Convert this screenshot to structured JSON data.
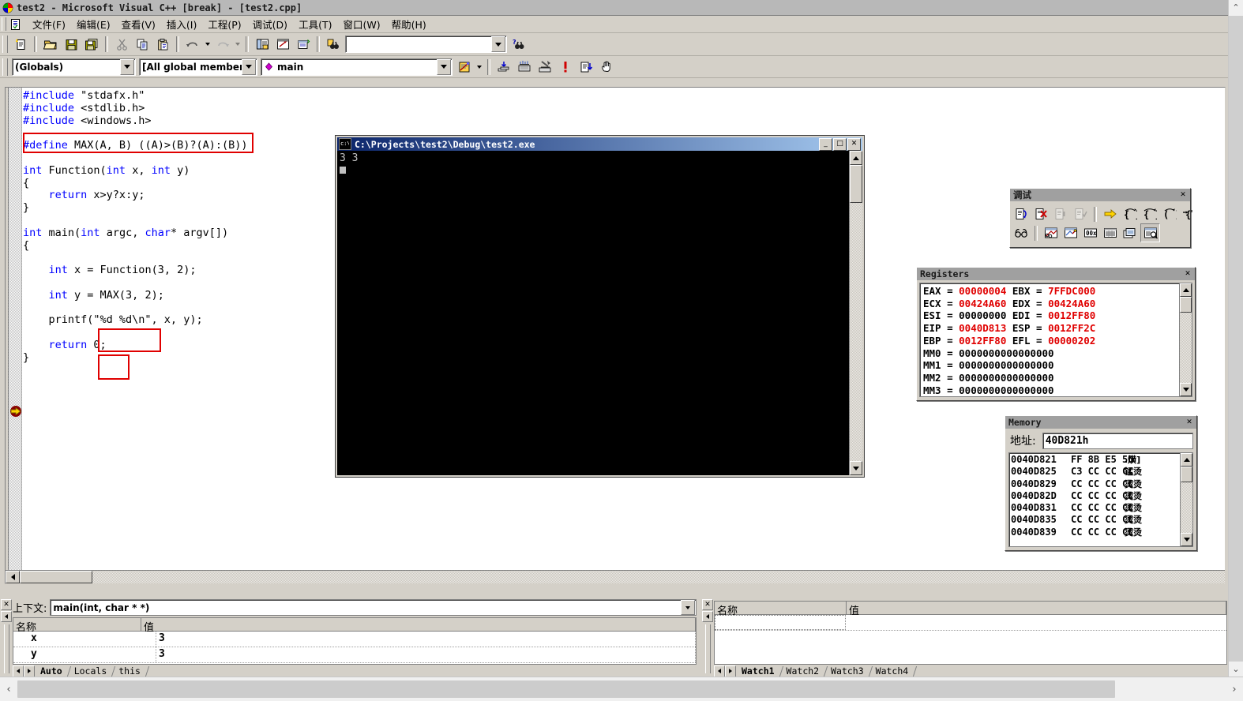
{
  "window": {
    "title": "test2 - Microsoft Visual C++ [break] - [test2.cpp]",
    "app_icon": "vc6-logo-icon"
  },
  "menubar": {
    "doc_icon": "document-icon",
    "items": [
      {
        "label": "文件(F)"
      },
      {
        "label": "编辑(E)"
      },
      {
        "label": "查看(V)"
      },
      {
        "label": "插入(I)"
      },
      {
        "label": "工程(P)"
      },
      {
        "label": "调试(D)"
      },
      {
        "label": "工具(T)"
      },
      {
        "label": "窗口(W)"
      },
      {
        "label": "帮助(H)"
      }
    ]
  },
  "standard_toolbar": {
    "buttons": [
      {
        "name": "new-text-file-button",
        "icon": "new-document-icon"
      },
      {
        "name": "open-button",
        "icon": "open-folder-icon"
      },
      {
        "name": "save-button",
        "icon": "floppy-save-icon"
      },
      {
        "name": "save-all-button",
        "icon": "floppy-save-all-icon"
      },
      {
        "name": "cut-button",
        "icon": "scissors-icon"
      },
      {
        "name": "copy-button",
        "icon": "copy-icon"
      },
      {
        "name": "paste-button",
        "icon": "clipboard-paste-icon"
      },
      {
        "name": "undo-button",
        "icon": "undo-arrow-icon"
      },
      {
        "name": "redo-button",
        "icon": "redo-arrow-icon"
      },
      {
        "name": "workspace-button",
        "icon": "workspace-window-icon"
      },
      {
        "name": "output-button",
        "icon": "output-window-icon"
      },
      {
        "name": "window-list-button",
        "icon": "window-list-icon"
      },
      {
        "name": "find-in-files-button",
        "icon": "binoculars-files-icon"
      }
    ],
    "find_box": {
      "value": "",
      "placeholder": ""
    },
    "help_button": {
      "name": "find-help-button",
      "icon": "question-binoculars-icon"
    }
  },
  "wizardbar": {
    "scope_combo": {
      "value": "(Globals)"
    },
    "members_combo": {
      "value": "[All global members]"
    },
    "function_combo": {
      "value": "main",
      "icon": "member-diamond-icon"
    },
    "action_button": {
      "name": "wizardbar-action-button",
      "icon": "wizard-action-icon"
    },
    "build_buttons": [
      {
        "name": "compile-button",
        "icon": "compile-icon"
      },
      {
        "name": "build-button",
        "icon": "build-icon"
      },
      {
        "name": "stop-build-button",
        "icon": "stop-build-icon"
      },
      {
        "name": "execute-program-button",
        "icon": "exclamation-run-icon"
      },
      {
        "name": "go-button",
        "icon": "go-debug-icon"
      },
      {
        "name": "insert-breakpoint-button",
        "icon": "hand-breakpoint-icon"
      }
    ]
  },
  "editor": {
    "filename": "test2.cpp",
    "lines": [
      {
        "tokens": [
          {
            "t": "#include",
            "c": "pp"
          },
          {
            "t": " \"stdafx.h\"",
            "c": ""
          }
        ]
      },
      {
        "tokens": [
          {
            "t": "#include",
            "c": "pp"
          },
          {
            "t": " <stdlib.h>",
            "c": ""
          }
        ]
      },
      {
        "tokens": [
          {
            "t": "#include",
            "c": "pp"
          },
          {
            "t": " <windows.h>",
            "c": ""
          }
        ]
      },
      {
        "tokens": []
      },
      {
        "tokens": [
          {
            "t": "#define",
            "c": "pp"
          },
          {
            "t": " MAX(A, B) ((A)>(B)?(A):(B))",
            "c": ""
          }
        ]
      },
      {
        "tokens": []
      },
      {
        "tokens": [
          {
            "t": "int",
            "c": "kw"
          },
          {
            "t": " Function(",
            "c": ""
          },
          {
            "t": "int",
            "c": "kw"
          },
          {
            "t": " x, ",
            "c": ""
          },
          {
            "t": "int",
            "c": "kw"
          },
          {
            "t": " y)",
            "c": ""
          }
        ]
      },
      {
        "tokens": [
          {
            "t": "{",
            "c": ""
          }
        ]
      },
      {
        "tokens": [
          {
            "t": "    ",
            "c": ""
          },
          {
            "t": "return",
            "c": "kw"
          },
          {
            "t": " x>y?x:y;",
            "c": ""
          }
        ]
      },
      {
        "tokens": [
          {
            "t": "}",
            "c": ""
          }
        ]
      },
      {
        "tokens": []
      },
      {
        "tokens": [
          {
            "t": "int",
            "c": "kw"
          },
          {
            "t": " main(",
            "c": ""
          },
          {
            "t": "int",
            "c": "kw"
          },
          {
            "t": " argc, ",
            "c": ""
          },
          {
            "t": "char",
            "c": "kw"
          },
          {
            "t": "* argv[])",
            "c": ""
          }
        ]
      },
      {
        "tokens": [
          {
            "t": "{",
            "c": ""
          }
        ]
      },
      {
        "tokens": []
      },
      {
        "tokens": [
          {
            "t": "    ",
            "c": ""
          },
          {
            "t": "int",
            "c": "kw"
          },
          {
            "t": " x = Function(3, 2);",
            "c": ""
          }
        ]
      },
      {
        "tokens": []
      },
      {
        "tokens": [
          {
            "t": "    ",
            "c": ""
          },
          {
            "t": "int",
            "c": "kw"
          },
          {
            "t": " y = MAX(3, 2);",
            "c": ""
          }
        ]
      },
      {
        "tokens": []
      },
      {
        "tokens": [
          {
            "t": "    printf(\"%d %d\\n\", x, y);",
            "c": ""
          }
        ]
      },
      {
        "tokens": []
      },
      {
        "tokens": [
          {
            "t": "    ",
            "c": ""
          },
          {
            "t": "return",
            "c": "kw"
          },
          {
            "t": " 0;",
            "c": ""
          }
        ]
      },
      {
        "tokens": [
          {
            "t": "}",
            "c": ""
          }
        ]
      }
    ],
    "annotations": [
      {
        "name": "define-macro-highlight-box",
        "color": "#e00000"
      },
      {
        "name": "function-call-highlight-box",
        "color": "#e00000"
      },
      {
        "name": "max-macro-call-highlight-box",
        "color": "#e00000"
      }
    ],
    "execution_marker": {
      "name": "current-statement-arrow",
      "line": "return 0;"
    }
  },
  "console": {
    "title": "C:\\Projects\\test2\\Debug\\test2.exe",
    "icon": "console-window-icon",
    "output": "3 3",
    "buttons": {
      "minimize": "_",
      "maximize": "□",
      "close": "✕"
    }
  },
  "debug_toolbar": {
    "title": "调试",
    "close_label": "✕",
    "row1": [
      {
        "name": "restart-button",
        "icon": "restart-debug-icon"
      },
      {
        "name": "stop-debugging-button",
        "icon": "stop-debug-icon"
      },
      {
        "name": "break-execution-button",
        "icon": "break-execution-icon"
      },
      {
        "name": "apply-code-changes-button",
        "icon": "apply-code-changes-icon"
      },
      {
        "name": "show-next-statement-button",
        "icon": "yellow-arrow-icon"
      },
      {
        "name": "step-into-button",
        "icon": "step-into-icon"
      },
      {
        "name": "step-over-button",
        "icon": "step-over-icon"
      },
      {
        "name": "step-out-button",
        "icon": "step-out-icon"
      },
      {
        "name": "run-to-cursor-button",
        "icon": "run-to-cursor-icon"
      }
    ],
    "row2": [
      {
        "name": "quickwatch-button",
        "icon": "glasses-quickwatch-icon"
      },
      {
        "name": "watch-window-button",
        "icon": "watch-window-icon"
      },
      {
        "name": "variables-window-button",
        "icon": "variables-window-icon"
      },
      {
        "name": "registers-window-button",
        "icon": "registers-window-icon"
      },
      {
        "name": "memory-window-button",
        "icon": "memory-window-icon"
      },
      {
        "name": "call-stack-window-button",
        "icon": "call-stack-icon"
      },
      {
        "name": "disassembly-window-button",
        "icon": "disassembly-icon"
      }
    ]
  },
  "registers": {
    "title": "Registers",
    "close_label": "✕",
    "rows": [
      {
        "pairs": [
          {
            "name": "EAX",
            "value": "00000004",
            "changed": true
          },
          {
            "name": "EBX",
            "value": "7FFDC000",
            "changed": true
          }
        ]
      },
      {
        "pairs": [
          {
            "name": "ECX",
            "value": "00424A60",
            "changed": true
          },
          {
            "name": "EDX",
            "value": "00424A60",
            "changed": true
          }
        ]
      },
      {
        "pairs": [
          {
            "name": "ESI",
            "value": "00000000",
            "changed": false
          },
          {
            "name": "EDI",
            "value": "0012FF80",
            "changed": true
          }
        ]
      },
      {
        "pairs": [
          {
            "name": "EIP",
            "value": "0040D813",
            "changed": true
          },
          {
            "name": "ESP",
            "value": "0012FF2C",
            "changed": true
          }
        ]
      },
      {
        "pairs": [
          {
            "name": "EBP",
            "value": "0012FF80",
            "changed": true
          },
          {
            "name": "EFL",
            "value": "00000202",
            "changed": true
          }
        ]
      },
      {
        "pairs": [
          {
            "name": "MM0",
            "value": "0000000000000000",
            "changed": false
          }
        ]
      },
      {
        "pairs": [
          {
            "name": "MM1",
            "value": "0000000000000000",
            "changed": false
          }
        ]
      },
      {
        "pairs": [
          {
            "name": "MM2",
            "value": "0000000000000000",
            "changed": false
          }
        ]
      },
      {
        "pairs": [
          {
            "name": "MM3",
            "value": "0000000000000000",
            "changed": false
          }
        ]
      }
    ]
  },
  "memory": {
    "title": "Memory",
    "close_label": "✕",
    "address_label": "地址:",
    "address_value": "40D821h",
    "rows": [
      {
        "address": "0040D821",
        "hex": "FF 8B E5 5D",
        "ascii": ".熿]"
      },
      {
        "address": "0040D825",
        "hex": "C3 CC CC CC",
        "ascii": "锰烫"
      },
      {
        "address": "0040D829",
        "hex": "CC CC CC CC",
        "ascii": "烫烫"
      },
      {
        "address": "0040D82D",
        "hex": "CC CC CC CC",
        "ascii": "烫烫"
      },
      {
        "address": "0040D831",
        "hex": "CC CC CC CC",
        "ascii": "烫烫"
      },
      {
        "address": "0040D835",
        "hex": "CC CC CC CC",
        "ascii": "烫烫"
      },
      {
        "address": "0040D839",
        "hex": "CC CC CC CC",
        "ascii": "烫烫"
      }
    ]
  },
  "variables_pane": {
    "close_label": "✕",
    "context_label": "上下文:",
    "context_value": "main(int, char * *)",
    "columns": [
      "名称",
      "值"
    ],
    "rows": [
      {
        "name": "x",
        "value": "3"
      },
      {
        "name": "y",
        "value": "3"
      }
    ],
    "tabs": [
      {
        "label": "Auto",
        "active": true
      },
      {
        "label": "Locals",
        "active": false
      },
      {
        "label": "this",
        "active": false
      }
    ]
  },
  "watch_pane": {
    "close_label": "✕",
    "columns": [
      "名称",
      "值"
    ],
    "rows": [
      {
        "name": "",
        "value": ""
      }
    ],
    "tabs": [
      {
        "label": "Watch1",
        "active": true
      },
      {
        "label": "Watch2",
        "active": false
      },
      {
        "label": "Watch3",
        "active": false
      },
      {
        "label": "Watch4",
        "active": false
      }
    ]
  },
  "viewer": {
    "scroll_up_icon": "chevron-up-icon",
    "scroll_left_icon": "chevron-left-icon",
    "scroll_right_icon": "chevron-right-icon"
  }
}
